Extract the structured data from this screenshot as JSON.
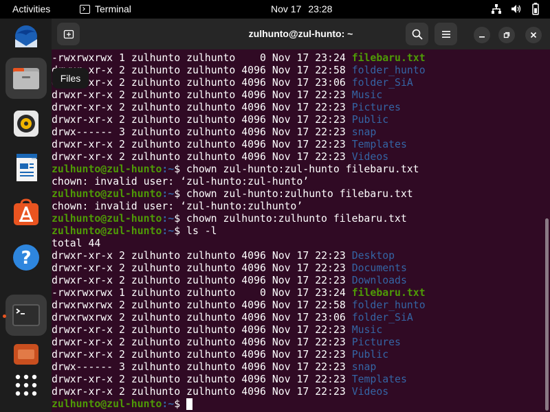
{
  "topbar": {
    "activities": "Activities",
    "app_name": "Terminal",
    "date": "Nov 17",
    "time": "23:28"
  },
  "dock": {
    "tooltip": "Files"
  },
  "terminal": {
    "title": "zulhunto@zul-hunto: ~",
    "prompt_user": "zulhunto@zul-hunto",
    "prompt_path": ":~",
    "prompt_symbol": "$",
    "lines": [
      {
        "kind": "ls",
        "perm": "-rwxrwxrwx",
        "links": "1",
        "owner": "zulhunto",
        "group": "zulhunto",
        "size": "0",
        "month": "Nov",
        "day": "17",
        "time": "23:24",
        "name": "filebaru.txt",
        "type": "exe"
      },
      {
        "kind": "ls",
        "perm": "drwxr-xr-x",
        "links": "2",
        "owner": "zulhunto",
        "group": "zulhunto",
        "size": "4096",
        "month": "Nov",
        "day": "17",
        "time": "22:58",
        "name": "folder_hunto",
        "type": "dir"
      },
      {
        "kind": "ls",
        "perm": "drwxr-xr-x",
        "links": "2",
        "owner": "zulhunto",
        "group": "zulhunto",
        "size": "4096",
        "month": "Nov",
        "day": "17",
        "time": "23:06",
        "name": "folder_SiA",
        "type": "dir"
      },
      {
        "kind": "ls",
        "perm": "drwxr-xr-x",
        "links": "2",
        "owner": "zulhunto",
        "group": "zulhunto",
        "size": "4096",
        "month": "Nov",
        "day": "17",
        "time": "22:23",
        "name": "Music",
        "type": "dir"
      },
      {
        "kind": "ls",
        "perm": "drwxr-xr-x",
        "links": "2",
        "owner": "zulhunto",
        "group": "zulhunto",
        "size": "4096",
        "month": "Nov",
        "day": "17",
        "time": "22:23",
        "name": "Pictures",
        "type": "dir"
      },
      {
        "kind": "ls",
        "perm": "drwxr-xr-x",
        "links": "2",
        "owner": "zulhunto",
        "group": "zulhunto",
        "size": "4096",
        "month": "Nov",
        "day": "17",
        "time": "22:23",
        "name": "Public",
        "type": "dir"
      },
      {
        "kind": "ls",
        "perm": "drwx------",
        "links": "3",
        "owner": "zulhunto",
        "group": "zulhunto",
        "size": "4096",
        "month": "Nov",
        "day": "17",
        "time": "22:23",
        "name": "snap",
        "type": "dir"
      },
      {
        "kind": "ls",
        "perm": "drwxr-xr-x",
        "links": "2",
        "owner": "zulhunto",
        "group": "zulhunto",
        "size": "4096",
        "month": "Nov",
        "day": "17",
        "time": "22:23",
        "name": "Templates",
        "type": "dir"
      },
      {
        "kind": "ls",
        "perm": "drwxr-xr-x",
        "links": "2",
        "owner": "zulhunto",
        "group": "zulhunto",
        "size": "4096",
        "month": "Nov",
        "day": "17",
        "time": "22:23",
        "name": "Videos",
        "type": "dir"
      },
      {
        "kind": "cmd",
        "text": "chown zul-hunto:zul-hunto filebaru.txt"
      },
      {
        "kind": "out",
        "text": "chown: invalid user: ‘zul-hunto:zul-hunto’"
      },
      {
        "kind": "cmd",
        "text": "chown zul-hunto:zulhunto filebaru.txt"
      },
      {
        "kind": "out",
        "text": "chown: invalid user: ‘zul-hunto:zulhunto’"
      },
      {
        "kind": "cmd",
        "text": "chown zulhunto:zulhunto filebaru.txt"
      },
      {
        "kind": "cmd",
        "text": "ls -l"
      },
      {
        "kind": "out",
        "text": "total 44"
      },
      {
        "kind": "ls",
        "perm": "drwxr-xr-x",
        "links": "2",
        "owner": "zulhunto",
        "group": "zulhunto",
        "size": "4096",
        "month": "Nov",
        "day": "17",
        "time": "22:23",
        "name": "Desktop",
        "type": "dir"
      },
      {
        "kind": "ls",
        "perm": "drwxr-xr-x",
        "links": "2",
        "owner": "zulhunto",
        "group": "zulhunto",
        "size": "4096",
        "month": "Nov",
        "day": "17",
        "time": "22:23",
        "name": "Documents",
        "type": "dir"
      },
      {
        "kind": "ls",
        "perm": "drwxr-xr-x",
        "links": "2",
        "owner": "zulhunto",
        "group": "zulhunto",
        "size": "4096",
        "month": "Nov",
        "day": "17",
        "time": "22:23",
        "name": "Downloads",
        "type": "dir"
      },
      {
        "kind": "ls",
        "perm": "-rwxrwxrwx",
        "links": "1",
        "owner": "zulhunto",
        "group": "zulhunto",
        "size": "0",
        "month": "Nov",
        "day": "17",
        "time": "23:24",
        "name": "filebaru.txt",
        "type": "exe"
      },
      {
        "kind": "ls",
        "perm": "drwxrwxrwx",
        "links": "2",
        "owner": "zulhunto",
        "group": "zulhunto",
        "size": "4096",
        "month": "Nov",
        "day": "17",
        "time": "22:58",
        "name": "folder_hunto",
        "type": "dir"
      },
      {
        "kind": "ls",
        "perm": "drwxrwxrwx",
        "links": "2",
        "owner": "zulhunto",
        "group": "zulhunto",
        "size": "4096",
        "month": "Nov",
        "day": "17",
        "time": "23:06",
        "name": "folder_SiA",
        "type": "dir"
      },
      {
        "kind": "ls",
        "perm": "drwxr-xr-x",
        "links": "2",
        "owner": "zulhunto",
        "group": "zulhunto",
        "size": "4096",
        "month": "Nov",
        "day": "17",
        "time": "22:23",
        "name": "Music",
        "type": "dir"
      },
      {
        "kind": "ls",
        "perm": "drwxr-xr-x",
        "links": "2",
        "owner": "zulhunto",
        "group": "zulhunto",
        "size": "4096",
        "month": "Nov",
        "day": "17",
        "time": "22:23",
        "name": "Pictures",
        "type": "dir"
      },
      {
        "kind": "ls",
        "perm": "drwxr-xr-x",
        "links": "2",
        "owner": "zulhunto",
        "group": "zulhunto",
        "size": "4096",
        "month": "Nov",
        "day": "17",
        "time": "22:23",
        "name": "Public",
        "type": "dir"
      },
      {
        "kind": "ls",
        "perm": "drwx------",
        "links": "3",
        "owner": "zulhunto",
        "group": "zulhunto",
        "size": "4096",
        "month": "Nov",
        "day": "17",
        "time": "22:23",
        "name": "snap",
        "type": "dir"
      },
      {
        "kind": "ls",
        "perm": "drwxr-xr-x",
        "links": "2",
        "owner": "zulhunto",
        "group": "zulhunto",
        "size": "4096",
        "month": "Nov",
        "day": "17",
        "time": "22:23",
        "name": "Templates",
        "type": "dir"
      },
      {
        "kind": "ls",
        "perm": "drwxr-xr-x",
        "links": "2",
        "owner": "zulhunto",
        "group": "zulhunto",
        "size": "4096",
        "month": "Nov",
        "day": "17",
        "time": "22:23",
        "name": "Videos",
        "type": "dir"
      },
      {
        "kind": "prompt",
        "text": ""
      }
    ]
  },
  "colors": {
    "terminal_bg": "#300a24",
    "prompt_user": "#4e9a06",
    "directory": "#3465a4",
    "executable": "#4e9a06",
    "ubuntu_orange": "#e95420"
  },
  "icons": {
    "dock": [
      "thunderbird-icon",
      "files-icon",
      "rhythmbox-icon",
      "writer-icon",
      "app-center-icon",
      "help-icon",
      "terminal-icon",
      "app-partial-icon",
      "show-apps-icon"
    ],
    "titlebar": [
      "new-tab-icon",
      "search-icon",
      "menu-icon",
      "minimize-icon",
      "maximize-icon",
      "close-icon"
    ],
    "tray": [
      "network-icon",
      "volume-icon",
      "battery-icon"
    ]
  }
}
